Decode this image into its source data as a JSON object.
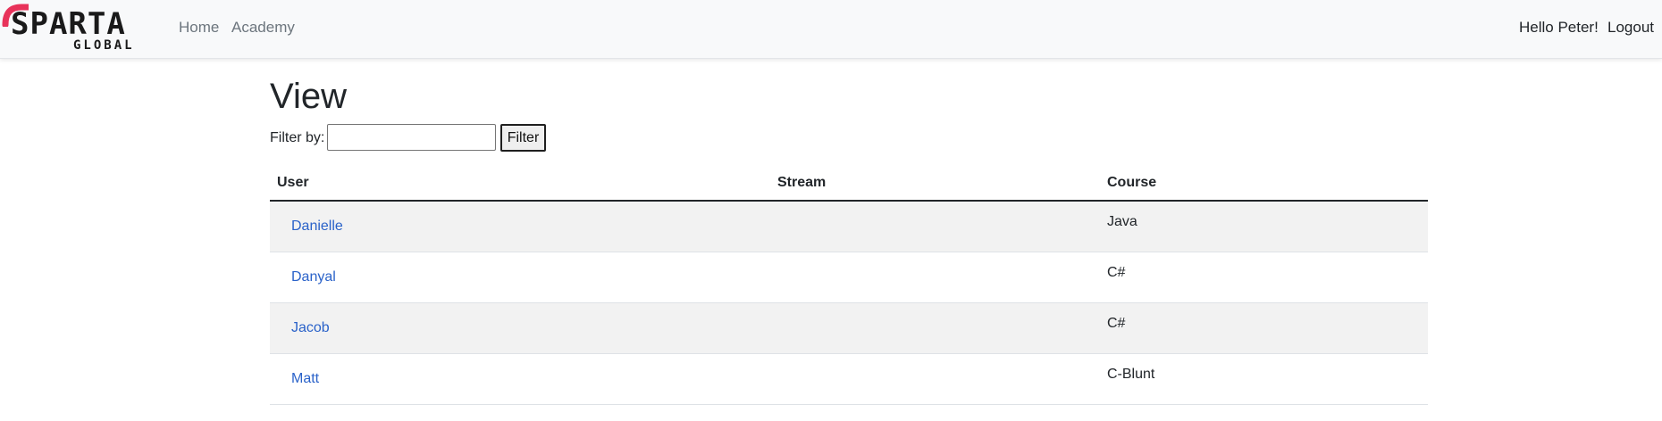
{
  "brand": {
    "name": "SPARTA",
    "tagline": "GLOBAL",
    "accent_color": "#e8335a"
  },
  "nav": {
    "links": [
      {
        "label": "Home"
      },
      {
        "label": "Academy"
      }
    ],
    "greeting": "Hello Peter!",
    "logout": "Logout"
  },
  "page": {
    "title": "View",
    "filter": {
      "label": "Filter by:",
      "value": "",
      "button": "Filter"
    }
  },
  "table": {
    "headers": {
      "user": "User",
      "stream": "Stream",
      "course": "Course"
    },
    "rows": [
      {
        "user": "Danielle",
        "stream": "",
        "course": "Java"
      },
      {
        "user": "Danyal",
        "stream": "",
        "course": "C#"
      },
      {
        "user": "Jacob",
        "stream": "",
        "course": "C#"
      },
      {
        "user": "Matt",
        "stream": "",
        "course": "C-Blunt"
      }
    ]
  }
}
